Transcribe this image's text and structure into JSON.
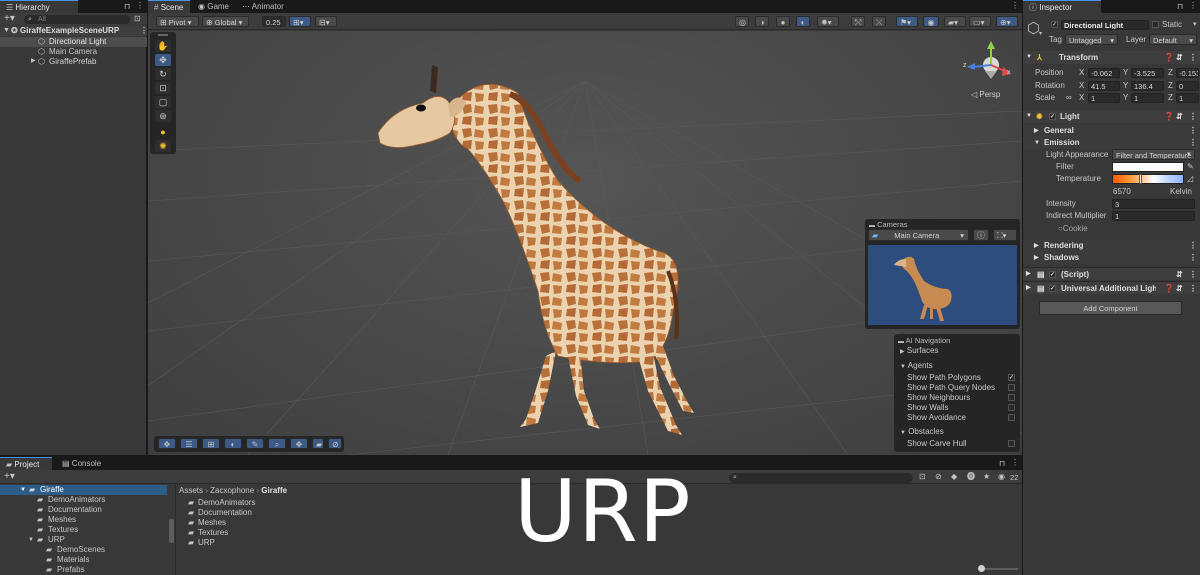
{
  "hierarchy": {
    "tab": "Hierarchy",
    "search_placeholder": "All",
    "scene": "GiraffeExampleSceneURP",
    "items": [
      "Directional Light",
      "Main Camera",
      "GiraffePrefab"
    ]
  },
  "scene_tabs": [
    "Scene",
    "Game",
    "Animator"
  ],
  "scene_toolbar": {
    "pivot": "Pivot",
    "global": "Global",
    "snap": "0.25"
  },
  "gizmo": {
    "x": "x",
    "z": "z",
    "persp": "Persp"
  },
  "cameras_overlay": {
    "title": "Cameras",
    "selected": "Main Camera"
  },
  "ai_navigation": {
    "title": "AI Navigation",
    "surfaces": "Surfaces",
    "agents": "Agents",
    "agent_options": [
      {
        "label": "Show Path Polygons",
        "checked": true
      },
      {
        "label": "Show Path Query Nodes",
        "checked": false
      },
      {
        "label": "Show Neighbours",
        "checked": false
      },
      {
        "label": "Show Walls",
        "checked": false
      },
      {
        "label": "Show Avoidance",
        "checked": false
      }
    ],
    "obstacles": "Obstacles",
    "obstacle_options": [
      {
        "label": "Show Carve Hull",
        "checked": false
      }
    ]
  },
  "inspector": {
    "tab": "Inspector",
    "object_name": "Directional Light",
    "static": "Static",
    "tag_label": "Tag",
    "tag_value": "Untagged",
    "layer_label": "Layer",
    "layer_value": "Default",
    "transform": {
      "title": "Transform",
      "rows": [
        {
          "label": "Position",
          "x": "-0.062",
          "y": "-3.525",
          "z": "-0.1533"
        },
        {
          "label": "Rotation",
          "x": "41.5",
          "y": "136.4",
          "z": "0"
        },
        {
          "label": "Scale",
          "x": "1",
          "y": "1",
          "z": "1"
        }
      ]
    },
    "light": {
      "title": "Light",
      "general": "General",
      "emission": "Emission",
      "light_appearance_label": "Light Appearance",
      "light_appearance_value": "Filter and Temperature",
      "filter_label": "Filter",
      "temperature_label": "Temperature",
      "temperature_value": "6570",
      "temperature_unit": "Kelvin",
      "intensity_label": "Intensity",
      "intensity_value": "3",
      "indirect_label": "Indirect Multiplier",
      "indirect_value": "1",
      "cookie_label": "Cookie",
      "rendering": "Rendering",
      "shadows": "Shadows"
    },
    "script": "(Script)",
    "additional": "Universal Additional Light Data",
    "add_component": "Add Component"
  },
  "project": {
    "tabs": [
      "Project",
      "Console"
    ],
    "tree": [
      {
        "label": "Giraffe",
        "depth": 0,
        "selected": true
      },
      {
        "label": "DemoAnimators",
        "depth": 1
      },
      {
        "label": "Documentation",
        "depth": 1
      },
      {
        "label": "Meshes",
        "depth": 1
      },
      {
        "label": "Textures",
        "depth": 1
      },
      {
        "label": "URP",
        "depth": 1
      },
      {
        "label": "DemoScenes",
        "depth": 2
      },
      {
        "label": "Materials",
        "depth": 2
      },
      {
        "label": "Prefabs",
        "depth": 2
      }
    ],
    "breadcrumb": [
      "Assets",
      "Zacxophone",
      "Giraffe"
    ],
    "folders": [
      "DemoAnimators",
      "Documentation",
      "Meshes",
      "Textures",
      "URP"
    ],
    "count": "22"
  },
  "overlay_text": "URP",
  "colors": {
    "accent": "#4a8ff2",
    "selected": "#2c5d87",
    "panel": "#383838",
    "viewport": "#474747",
    "preview_bg": "#2d4d7e"
  }
}
